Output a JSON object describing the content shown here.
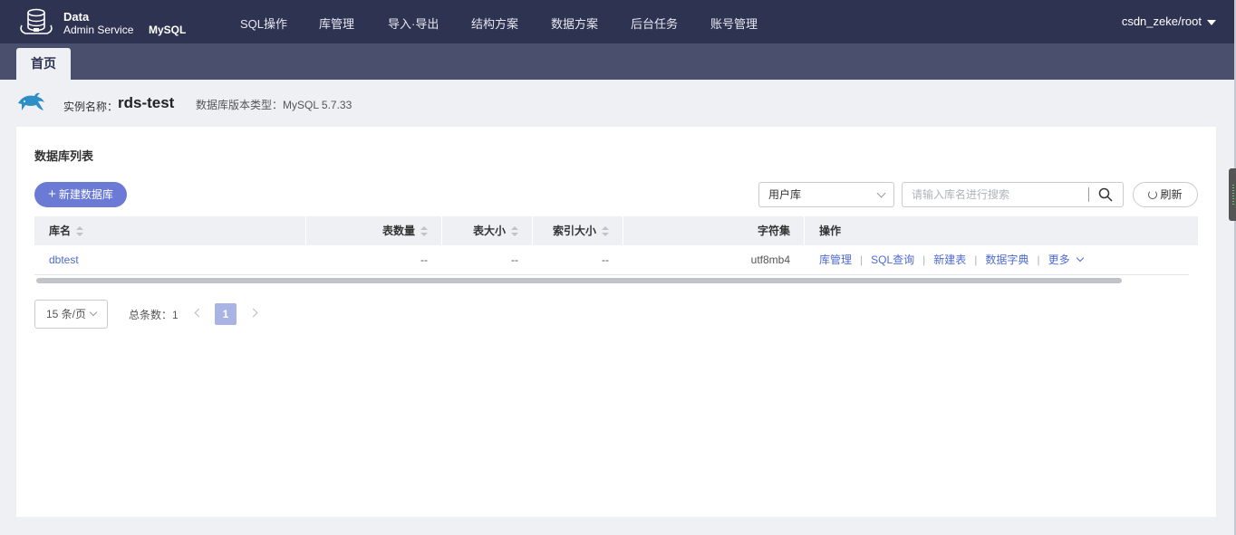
{
  "brand": {
    "line1": "Data",
    "line2": "Admin Service",
    "engine": "MySQL"
  },
  "nav": [
    "SQL操作",
    "库管理",
    "导入·导出",
    "结构方案",
    "数据方案",
    "后台任务",
    "账号管理"
  ],
  "user": "csdn_zeke/root",
  "tabs": [
    "首页"
  ],
  "instance": {
    "label": "实例名称：",
    "name": "rds-test",
    "version": "数据库版本类型：MySQL 5.7.33"
  },
  "panel": {
    "title": "数据库列表",
    "new_button": "新建数据库",
    "filter_select": "用户库",
    "search_placeholder": "请输入库名进行搜索",
    "refresh_button": "刷新"
  },
  "table": {
    "columns": [
      "库名",
      "表数量",
      "表大小",
      "索引大小",
      "字符集",
      "操作"
    ],
    "rows": [
      {
        "name": "dbtest",
        "table_count": "--",
        "table_size": "--",
        "index_size": "--",
        "charset": "utf8mb4",
        "actions": [
          "库管理",
          "SQL查询",
          "新建表",
          "数据字典",
          "更多"
        ]
      }
    ]
  },
  "pagination": {
    "page_size": "15 条/页",
    "total": "总条数：1",
    "current_page": "1"
  },
  "colors": {
    "topbar": "#2f3352",
    "tabbar": "#4b4f6e",
    "accent": "#6b7ad4",
    "link": "#4e6bd0"
  }
}
